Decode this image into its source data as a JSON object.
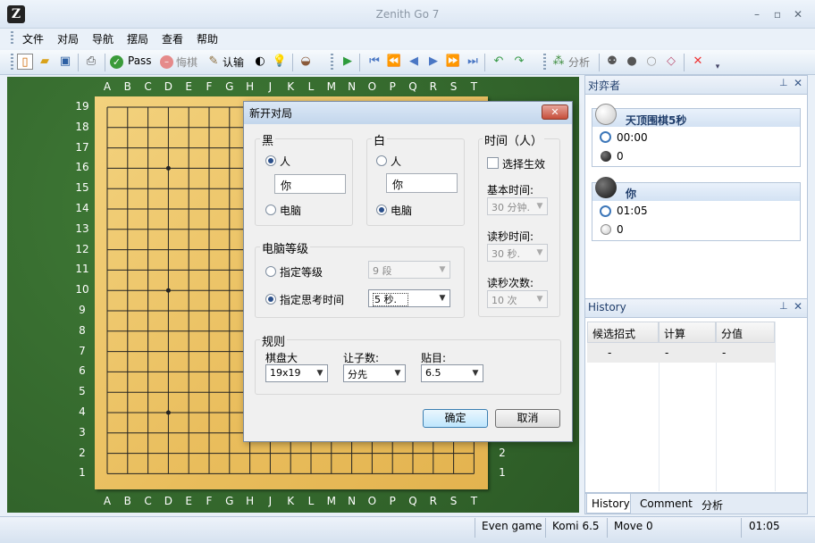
{
  "window": {
    "title": "Zenith Go 7",
    "min": "–",
    "max": "▫",
    "close": "✕"
  },
  "menu": [
    "文件",
    "对局",
    "导航",
    "摆局",
    "查看",
    "帮助"
  ],
  "toolbar": {
    "pass": "Pass",
    "undo": "悔棋",
    "resign": "认输",
    "analyze": "分析"
  },
  "board": {
    "columns": [
      "A",
      "B",
      "C",
      "D",
      "E",
      "F",
      "G",
      "H",
      "J",
      "K",
      "L",
      "M",
      "N",
      "O",
      "P",
      "Q",
      "R",
      "S",
      "T"
    ],
    "rows": [
      "19",
      "18",
      "17",
      "16",
      "15",
      "14",
      "13",
      "12",
      "11",
      "10",
      "9",
      "8",
      "7",
      "6",
      "5",
      "4",
      "3",
      "2",
      "1"
    ]
  },
  "dialog": {
    "title": "新开对局",
    "black": {
      "label": "黑",
      "human": "人",
      "name": "你",
      "computer": "电脑",
      "selected": "human"
    },
    "white": {
      "label": "白",
      "human": "人",
      "name": "你",
      "computer": "电脑",
      "selected": "computer"
    },
    "time": {
      "label": "时间（人）",
      "enable": "选择生效",
      "basic_label": "基本时间:",
      "basic_value": "30 分钟.",
      "byo_label": "读秒时间:",
      "byo_value": "30 秒.",
      "periods_label": "读秒次数:",
      "periods_value": "10 次"
    },
    "level": {
      "label": "电脑等级",
      "fixed": "指定等级",
      "fixed_value": "9 段",
      "think": "指定思考时间",
      "think_value": "5 秒.",
      "selected": "think"
    },
    "rules": {
      "label": "规则",
      "size_label": "棋盘大",
      "size_value": "19x19",
      "handicap_label": "让子数:",
      "handicap_value": "分先",
      "komi_label": "贴目:",
      "komi_value": "6.5"
    },
    "ok": "确定",
    "cancel": "取消"
  },
  "players_pane": {
    "title": "对弈者",
    "white_player": {
      "name": "天顶围棋5秒",
      "time": "00:00",
      "captures": "0"
    },
    "black_player": {
      "name": "你",
      "time": "01:05",
      "captures": "0"
    }
  },
  "history_pane": {
    "title": "History",
    "columns": [
      "候选招式",
      "计算",
      "分值"
    ],
    "rows": [
      [
        "-",
        "-",
        "-"
      ]
    ],
    "tabs": [
      "History",
      "Comment",
      "分析"
    ]
  },
  "status": {
    "game": "Even game",
    "komi": "Komi 6.5",
    "move": "Move 0",
    "time": "01:05"
  }
}
